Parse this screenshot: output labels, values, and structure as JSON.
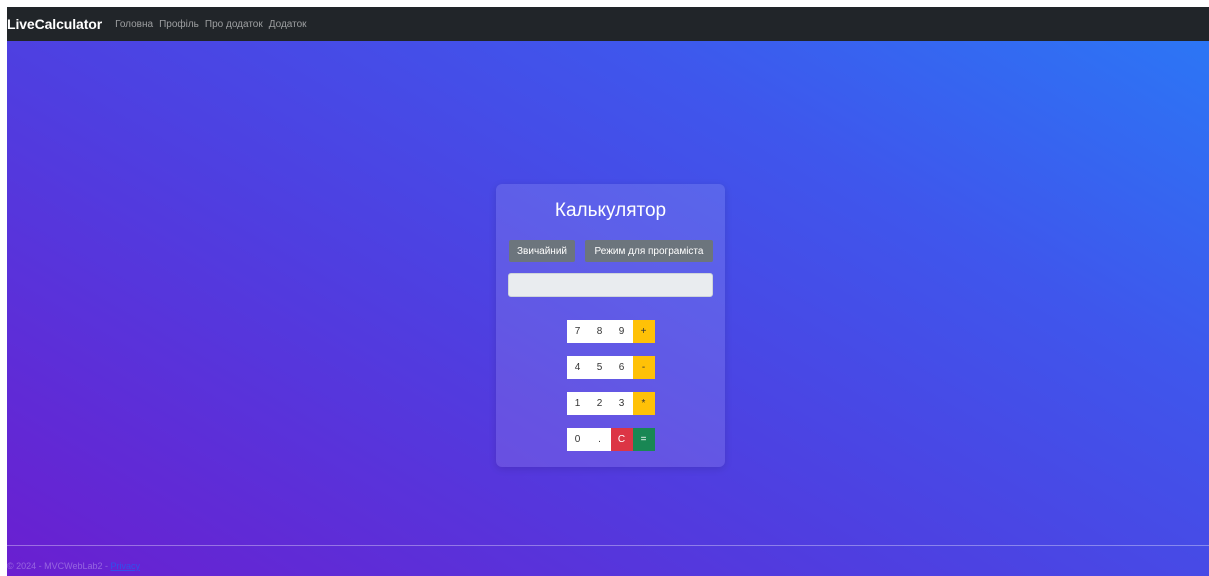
{
  "navbar": {
    "brand": "LiveCalculator",
    "links": [
      "Головна",
      "Профіль",
      "Про додаток",
      "Додаток"
    ]
  },
  "calculator": {
    "title": "Калькулятор",
    "modes": {
      "normal": "Звичайний",
      "programmer": "Режим для програміста"
    },
    "display_value": "",
    "rows": [
      [
        "7",
        "8",
        "9",
        "+"
      ],
      [
        "4",
        "5",
        "6",
        "-"
      ],
      [
        "1",
        "2",
        "3",
        "*"
      ],
      [
        "0",
        ".",
        "C",
        "="
      ]
    ]
  },
  "footer": {
    "text": "© 2024 - MVCWebLab2 - ",
    "privacy": "Privacy"
  },
  "colors": {
    "navbar": "#212529",
    "operator": "#ffc107",
    "clear": "#dc3545",
    "equals": "#198754",
    "mode_button": "#6c757d"
  }
}
